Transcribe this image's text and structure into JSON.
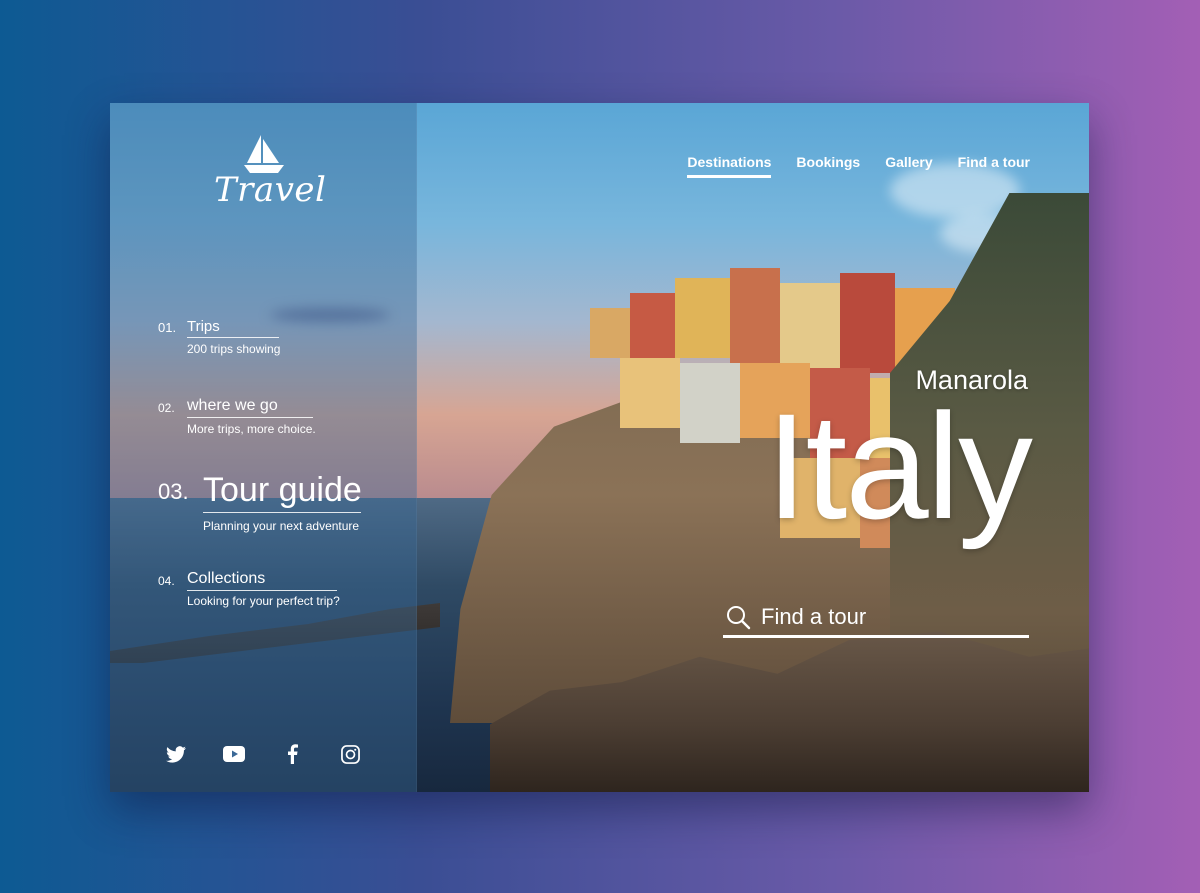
{
  "brand": {
    "name": "Travel",
    "logo_icon": "sailboat-icon"
  },
  "nav": {
    "items": [
      {
        "label": "Destinations",
        "active": true
      },
      {
        "label": "Bookings",
        "active": false
      },
      {
        "label": "Gallery",
        "active": false
      },
      {
        "label": "Find a tour",
        "active": false
      }
    ]
  },
  "menu": [
    {
      "number": "01.",
      "title": "Trips",
      "subtitle": "200 trips showing"
    },
    {
      "number": "02.",
      "title": "where we go",
      "subtitle": "More trips, more choice."
    },
    {
      "number": "03.",
      "title": "Tour guide",
      "subtitle": "Planning your next adventure"
    },
    {
      "number": "04.",
      "title": "Collections",
      "subtitle": "Looking for your perfect trip?"
    }
  ],
  "hero": {
    "subtitle": "Manarola",
    "title": "Italy",
    "search_placeholder": "Find a tour",
    "search_icon": "search-icon"
  },
  "social": [
    "twitter-icon",
    "youtube-icon",
    "facebook-icon",
    "instagram-icon"
  ],
  "colors": {
    "accent": "#ffffff",
    "panel": "#3a6896"
  }
}
